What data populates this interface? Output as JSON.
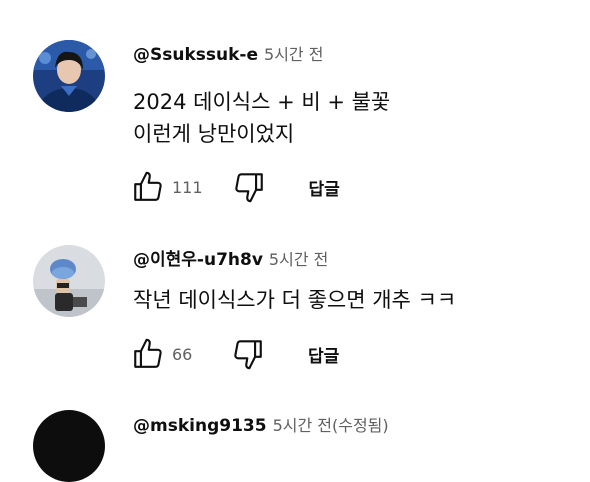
{
  "comments": [
    {
      "author": "@Ssukssuk-e",
      "time": "5시간 전",
      "lines": [
        "2024  데이식스 + 비 + 불꽃",
        "이런게 낭만이었지"
      ],
      "likes": "111",
      "reply_label": "답글"
    },
    {
      "author": "@이현우-u7h8v",
      "time": "5시간 전",
      "lines": [
        "작년 데이식스가 더 좋으면 개추 ㅋㅋ"
      ],
      "likes": "66",
      "reply_label": "답글"
    },
    {
      "author": "@msking9135",
      "time": "5시간 전(수정됨)"
    }
  ],
  "colors": {
    "author": "#0f0f0f",
    "secondary": "#606060"
  }
}
